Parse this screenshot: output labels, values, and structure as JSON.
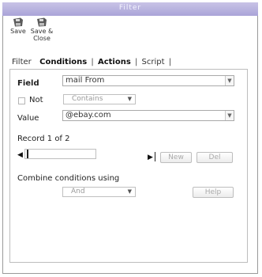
{
  "window": {
    "title": "Filter"
  },
  "toolbar": {
    "save_label": "Save",
    "save_close_label_line1": "Save &",
    "save_close_label_line2": "Close",
    "icon": "floppy-disk-icon"
  },
  "tabs": [
    {
      "label": "Filter",
      "active": false
    },
    {
      "label": "Conditions",
      "active": true
    },
    {
      "label": "Actions",
      "active": false
    },
    {
      "label": "Script",
      "active": false
    }
  ],
  "conditions": {
    "field_label": "Field",
    "field_value": "mail From",
    "not_label": "Not",
    "not_checked": false,
    "operator_value": "Contains",
    "value_label": "Value",
    "value_value": "@ebay.com",
    "record_label": "Record",
    "record_current": "1",
    "record_of": "of",
    "record_total": "2",
    "new_button": "New",
    "del_button": "Del",
    "combine_label": "Combine conditions using",
    "combine_value": "And",
    "help_button": "Help"
  },
  "colors": {
    "titlebar": "#aaa4d8",
    "border": "#9a9a9a"
  }
}
